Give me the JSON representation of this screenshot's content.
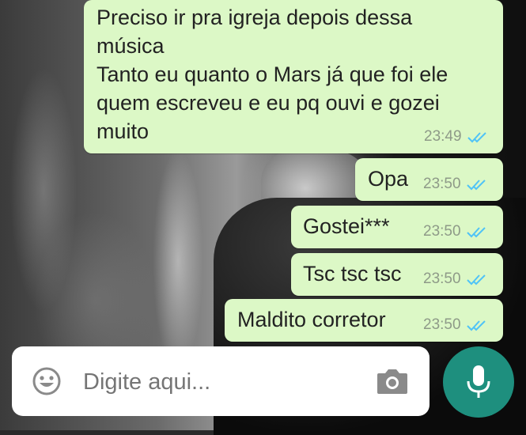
{
  "chat": {
    "messages": [
      {
        "text": "Preciso ir pra igreja depois dessa\nmúsica\nTanto eu quanto o Mars já que foi ele\nquem escreveu e eu pq ouvi e gozei\nmuito",
        "time": "23:49",
        "status": "read"
      },
      {
        "text": "Opa",
        "time": "23:50",
        "status": "read"
      },
      {
        "text": "Gostei***",
        "time": "23:50",
        "status": "read"
      },
      {
        "text": "Tsc tsc tsc",
        "time": "23:50",
        "status": "read"
      },
      {
        "text": "Maldito corretor",
        "time": "23:50",
        "status": "read"
      }
    ]
  },
  "composer": {
    "placeholder": "Digite aqui...",
    "emoji_icon": "emoji-icon",
    "camera_icon": "camera-icon",
    "mic_icon": "mic-icon"
  },
  "colors": {
    "bubble": "#dcf8c6",
    "tick": "#4fc3f7",
    "mic_button": "#1e8f7e",
    "time": "#8e9a88"
  }
}
